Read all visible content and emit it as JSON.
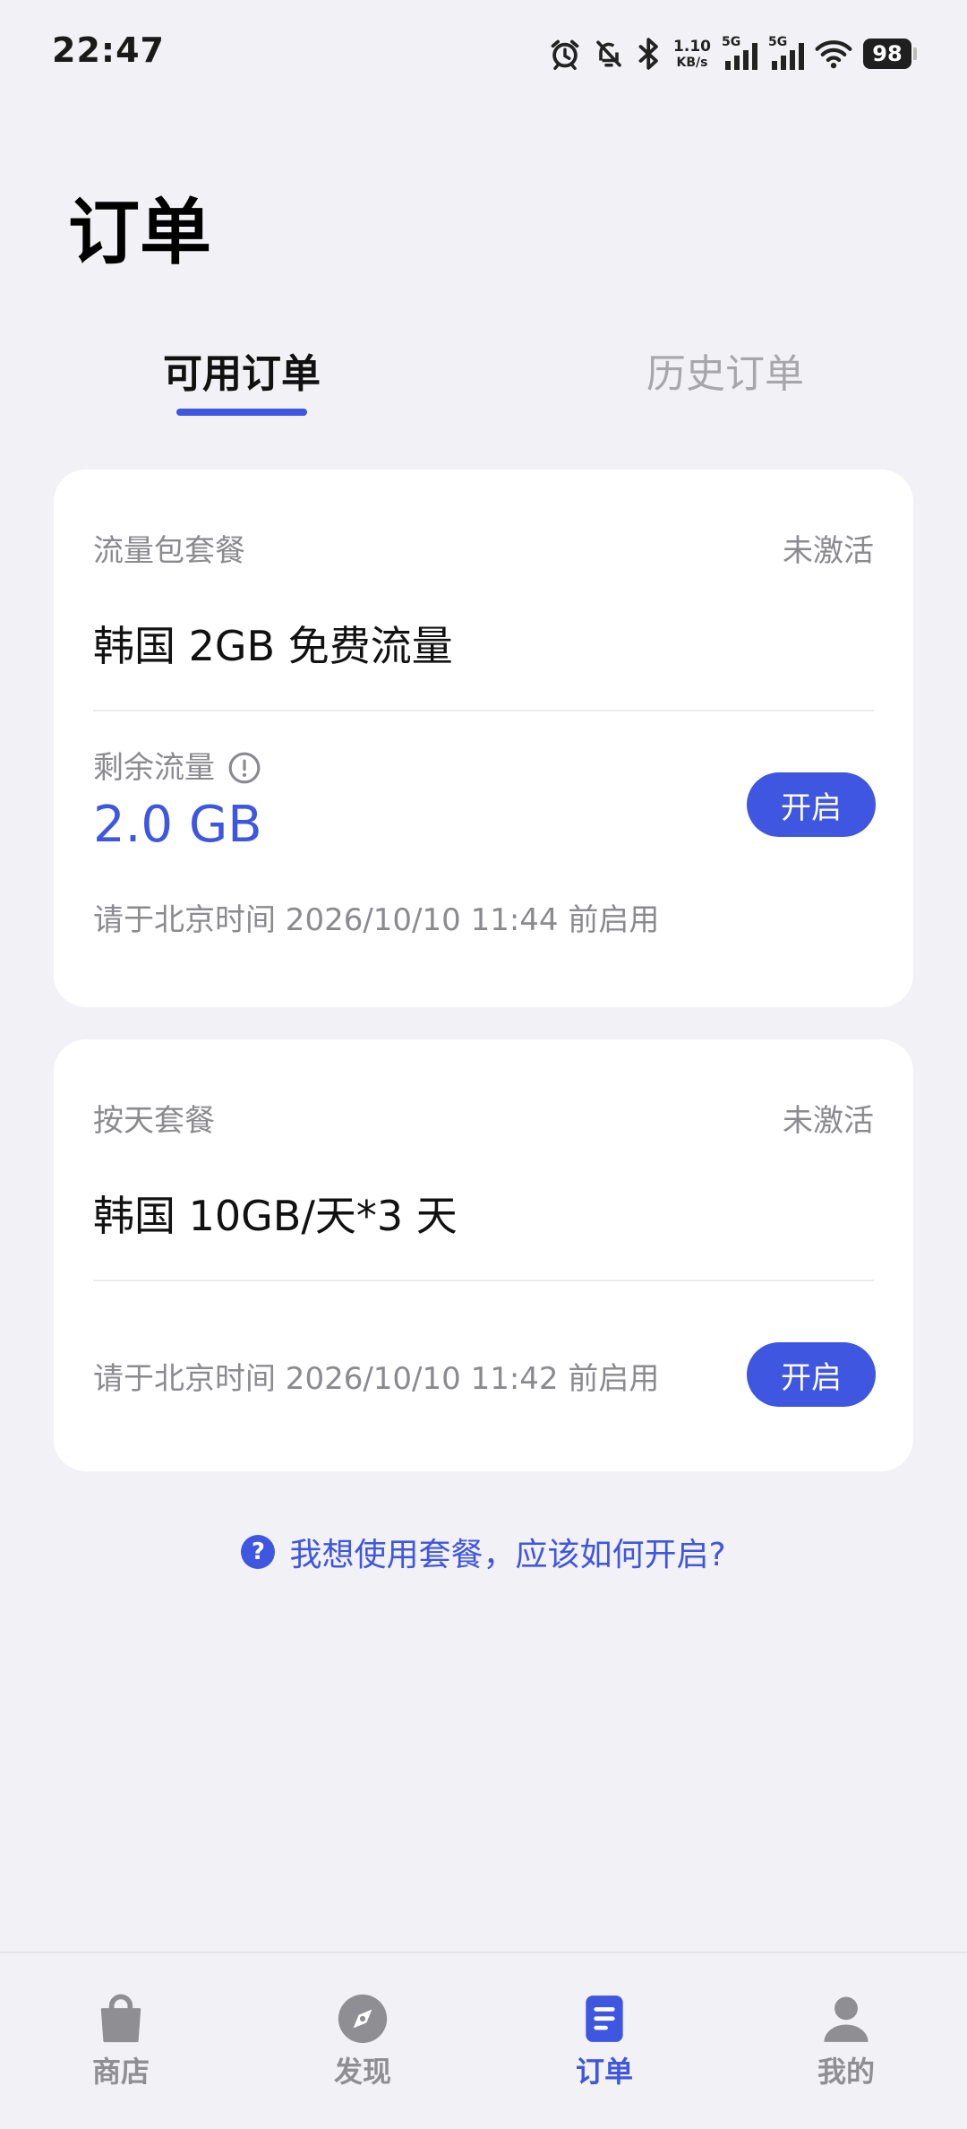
{
  "status_bar": {
    "time": "22:47",
    "net_speed_value": "1.10",
    "net_speed_unit": "KB/s",
    "sim1_label": "5G",
    "sim2_label": "5G",
    "battery": "98",
    "icons": [
      "alarm-icon",
      "bell-muted-icon",
      "bluetooth-icon",
      "signal-icon",
      "signal-icon",
      "wifi-icon",
      "battery-icon"
    ]
  },
  "page": {
    "title": "订单"
  },
  "tabs": [
    {
      "label": "可用订单",
      "active": true
    },
    {
      "label": "历史订单",
      "active": false
    }
  ],
  "orders": [
    {
      "category": "流量包套餐",
      "status": "未激活",
      "name": "韩国 2GB 免费流量",
      "remaining_label": "剩余流量",
      "remaining_value": "2.0 GB",
      "activate_hint": "请于北京时间 2026/10/10 11:44 前启用",
      "button_label": "开启"
    },
    {
      "category": "按天套餐",
      "status": "未激活",
      "name": "韩国 10GB/天*3 天",
      "activate_hint": "请于北京时间 2026/10/10 11:42 前启用",
      "button_label": "开启"
    }
  ],
  "help": {
    "icon": "question-circle-icon",
    "text": "我想使用套餐，应该如何开启?"
  },
  "bottom_nav": [
    {
      "label": "商店",
      "icon": "shopping-bag-icon",
      "active": false
    },
    {
      "label": "发现",
      "icon": "compass-icon",
      "active": false
    },
    {
      "label": "订单",
      "icon": "document-icon",
      "active": true
    },
    {
      "label": "我的",
      "icon": "person-icon",
      "active": false
    }
  ],
  "colors": {
    "accent": "#3e56e0",
    "background": "#f2f2f6",
    "card": "#ffffff",
    "muted_text": "#8a8a8f",
    "inactive_tab": "#a6a6ab"
  }
}
